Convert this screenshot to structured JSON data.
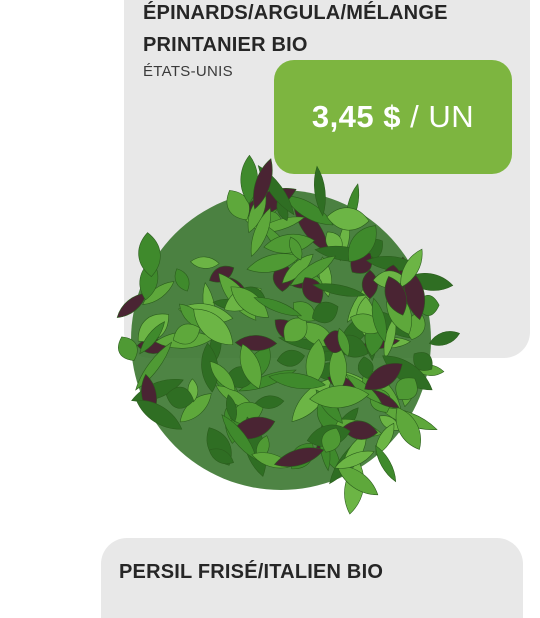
{
  "product_top": {
    "name_line1": "ÉPINARDS/ARGULA/MÉLANGE",
    "name_line2": "PRINTANIER BIO",
    "origin": "ÉTATS-UNIS",
    "price_amount": "3,45 $",
    "price_unit": " / UN"
  },
  "product_bottom": {
    "name": "PERSIL FRISÉ/ITALIEN BIO"
  },
  "colors": {
    "price_badge": "#7db540",
    "card_bg": "#e8e8e8",
    "leaf_green": "#4f9a34",
    "leaf_dark_green": "#2f6e23",
    "leaf_purple": "#4a2433"
  },
  "image": {
    "icon": "salad-mix-image"
  }
}
